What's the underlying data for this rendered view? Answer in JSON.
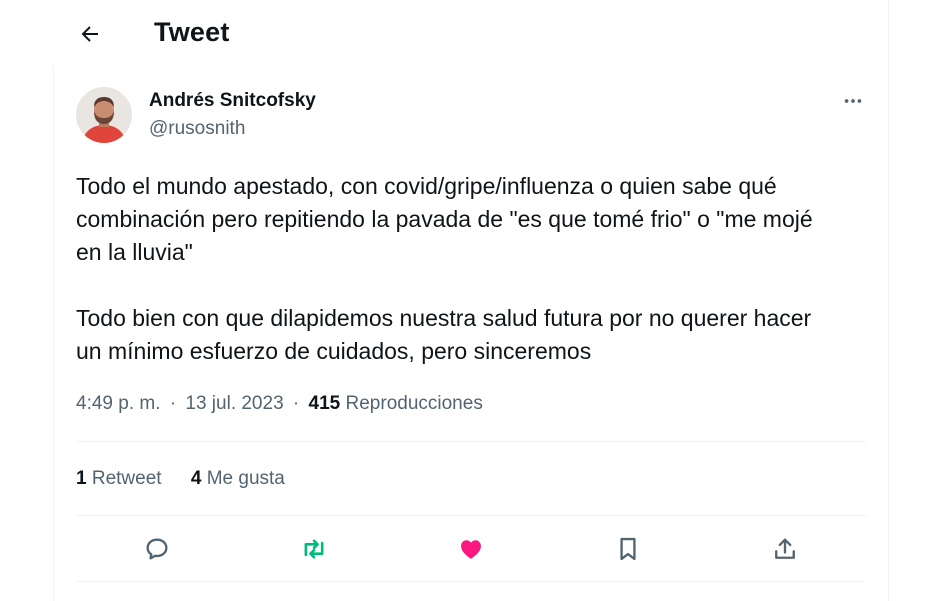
{
  "header": {
    "title": "Tweet",
    "back_icon": "arrow-left-icon"
  },
  "tweet": {
    "author": {
      "name": "Andrés Snitcofsky",
      "handle": "@rusosnith",
      "avatar_colors": {
        "background": "#e9e6e1",
        "skin": "#c98d70",
        "beard": "#6b4636",
        "shirt": "#e0453c"
      }
    },
    "text_paragraphs": [
      "Todo el mundo apestado, con covid/gripe/influenza o quien sabe qué\ncombinación pero repitiendo la pavada de \"es que tomé frio\" o \"me mojé\nen la lluvia\"",
      "Todo bien con que dilapidemos nuestra salud futura por no querer hacer\nun mínimo esfuerzo de cuidados, pero sinceremos"
    ],
    "meta": {
      "time": "4:49 p. m.",
      "separator": "·",
      "date": "13 jul. 2023",
      "views_count": "415",
      "views_label": "Reproducciones"
    },
    "stats": {
      "retweets_count": "1",
      "retweets_label": "Retweet",
      "likes_count": "4",
      "likes_label": "Me gusta"
    },
    "actions": [
      {
        "name": "reply",
        "icon": "comment-icon",
        "color": "#536471"
      },
      {
        "name": "retweet",
        "icon": "retweet-icon",
        "color": "#00ba7c"
      },
      {
        "name": "like",
        "icon": "heart-icon",
        "color": "#f91880"
      },
      {
        "name": "bookmark",
        "icon": "bookmark-icon",
        "color": "#536471"
      },
      {
        "name": "share",
        "icon": "share-icon",
        "color": "#536471"
      }
    ]
  },
  "colors": {
    "text": "#0f1419",
    "secondary": "#536471",
    "border": "#eff3f4"
  }
}
